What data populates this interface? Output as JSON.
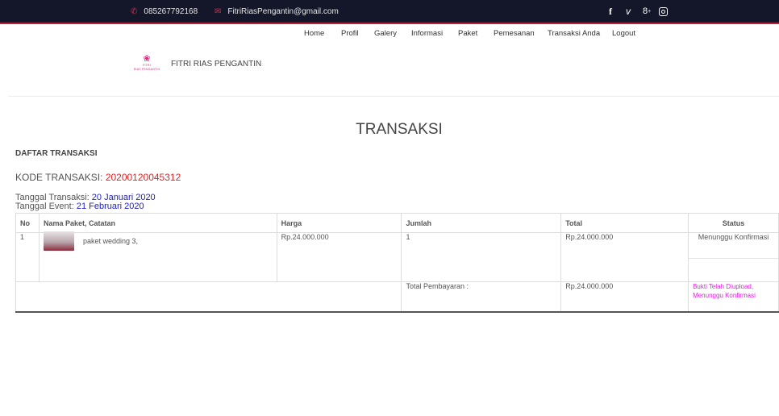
{
  "topbar": {
    "phone": "085267792168",
    "email": "FitriRiasPengantin@gmail.com",
    "social_icons": [
      "facebook-icon",
      "vimeo-icon",
      "google-plus-icon",
      "instagram-icon"
    ]
  },
  "nav": {
    "items": [
      "Home",
      "Profil",
      "Galery",
      "Informasi",
      "Paket",
      "Pemesanan",
      "Transaksi Anda",
      "Logout"
    ]
  },
  "brand": {
    "logo_text_1": "FITRI",
    "logo_text_2": "RIAS PENGANTIN",
    "name": "FITRI RIAS PENGANTIN"
  },
  "page": {
    "title": "TRANSAKSI",
    "section_title": "DAFTAR TRANSAKSI",
    "code_label": "KODE TRANSAKSI: ",
    "code_value": "20200120045312",
    "trx_date_label": "Tanggal Transaksi: ",
    "trx_date_value": "20 Januari 2020",
    "event_date_label": "Tanggal Event: ",
    "event_date_value": "21 Februari 2020"
  },
  "table": {
    "headers": [
      "No",
      "Nama Paket, Catatan",
      "Harga",
      "Jumlah",
      "Total",
      "Status"
    ],
    "rows": [
      {
        "no": "1",
        "package": "paket wedding 3,",
        "price": "Rp.24.000.000",
        "qty": "1",
        "total": "Rp.24.000.000",
        "status": "Menunggu Konfirmasi"
      }
    ],
    "footer": {
      "label": "Total Pembayaran :",
      "amount": "Rp.24.000.000",
      "status_line1": "Bukti Telah Diupload,",
      "status_line2": "Menunggu Konfirmasi"
    }
  },
  "colors": {
    "topbar_bg": "#14172a",
    "accent_red": "#e02424",
    "date_blue": "#2020c8",
    "money_green": "#2e7d32",
    "upload_magenta": "#e020e0"
  }
}
